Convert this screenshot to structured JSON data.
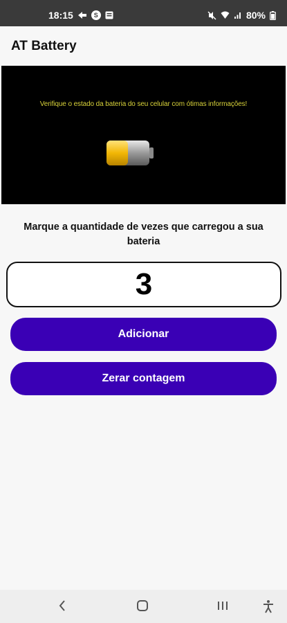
{
  "status_bar": {
    "time": "18:15",
    "battery_percent": "80%",
    "left_icons": [
      "data-saver-icon",
      "s-badge-icon",
      "gallery-icon"
    ],
    "right_icons": [
      "mute-icon",
      "wifi-icon",
      "signal-icon",
      "battery-icon"
    ],
    "badge_letter": "S"
  },
  "app_bar": {
    "title": "AT Battery"
  },
  "banner": {
    "text": "Verifique o estado da bateria do seu celular com ótimas informações!",
    "battery_level": 0.5,
    "colors": {
      "background": "#000000",
      "text": "#d8d23a",
      "charge": "#f2b705"
    }
  },
  "main": {
    "prompt": "Marque a quantidade de vezes que carregou a sua bateria",
    "count": "3",
    "add_button": "Adicionar",
    "reset_button": "Zerar contagem",
    "accent_color": "#3a00b5"
  },
  "nav_bar": {
    "icons": [
      "back-icon",
      "home-icon",
      "recents-icon",
      "accessibility-icon"
    ]
  }
}
